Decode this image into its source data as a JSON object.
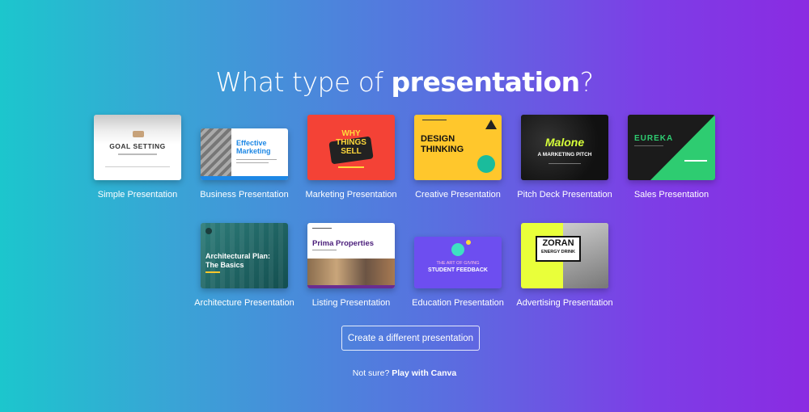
{
  "heading": {
    "prefix": "What type of ",
    "bold": "presentation",
    "suffix": "?"
  },
  "row1": [
    {
      "label": "Simple Presentation",
      "thumb_title": "GOAL SETTING"
    },
    {
      "label": "Business Presentation",
      "thumb_title": "Effective Marketing"
    },
    {
      "label": "Marketing Presentation",
      "thumb_title": "WHY THINGS SELL"
    },
    {
      "label": "Creative Presentation",
      "thumb_title": "DESIGN THINKING"
    },
    {
      "label": "Pitch Deck Presentation",
      "thumb_title": "Malone",
      "thumb_sub": "A MARKETING PITCH"
    },
    {
      "label": "Sales Presentation",
      "thumb_title": "EUREKA"
    }
  ],
  "row2": [
    {
      "label": "Architecture Presentation",
      "thumb_title": "Architectural Plan: The Basics"
    },
    {
      "label": "Listing Presentation",
      "thumb_title": "Prima Properties"
    },
    {
      "label": "Education Presentation",
      "thumb_title": "STUDENT FEEDBACK",
      "thumb_sub": "THE ART OF GIVING"
    },
    {
      "label": "Advertising Presentation",
      "thumb_title": "ZORAN",
      "thumb_sub": "ENERGY DRINK"
    }
  ],
  "cta": {
    "label": "Create a different presentation"
  },
  "footer": {
    "prefix": "Not sure?",
    "link": "Play with Canva"
  },
  "colors": {
    "marketing_bg": "#f44236",
    "creative_bg": "#ffc72c",
    "sales_accent": "#2ecc71",
    "education_bg": "#6d4ef0",
    "advert_yellow": "#e9ff3a"
  }
}
